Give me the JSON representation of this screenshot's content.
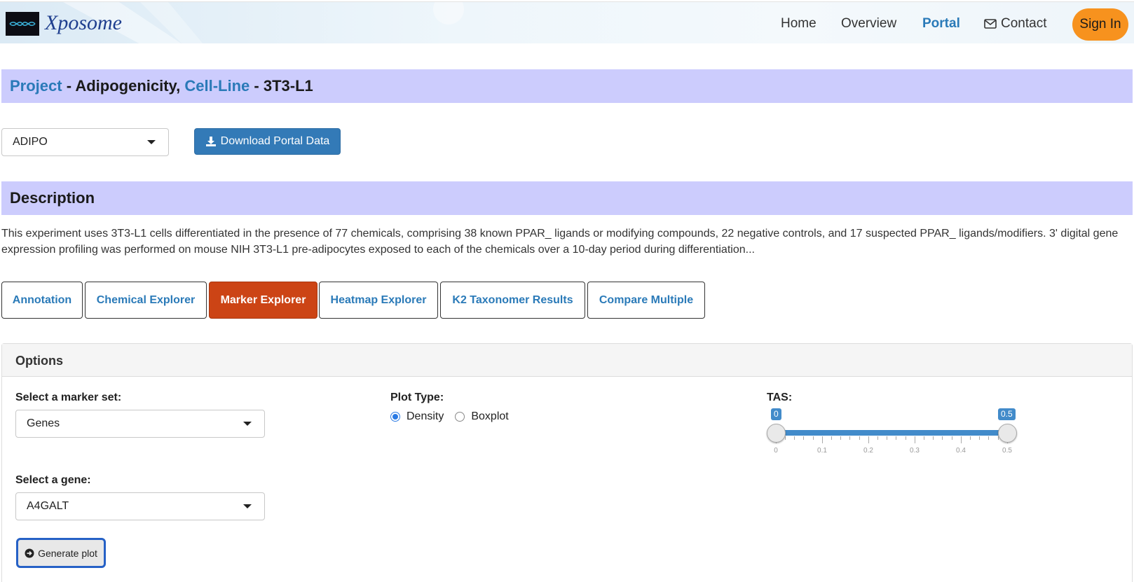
{
  "nav": {
    "brand": "Xposome",
    "links": [
      {
        "label": "Home",
        "active": false
      },
      {
        "label": "Overview",
        "active": false
      },
      {
        "label": "Portal",
        "active": true
      },
      {
        "label": "Contact",
        "active": false,
        "icon": "envelope-icon"
      }
    ],
    "signin": "Sign In"
  },
  "project_header": {
    "project_link": "Project",
    "project_text": " - Adipogenicity, ",
    "cellline_link": "Cell-Line",
    "cellline_text": " - 3T3-L1"
  },
  "project_select": {
    "value": "ADIPO"
  },
  "download_button": {
    "label": "Download Portal Data",
    "icon": "download-icon"
  },
  "description": {
    "heading": "Description",
    "text": "This experiment uses 3T3-L1 cells differentiated in the presence of 77 chemicals, comprising 38 known PPAR_ ligands or modifying compounds, 22 negative controls, and 17 suspected PPAR_ ligands/modifiers. 3' digital gene expression profiling was performed on mouse NIH 3T3-L1 pre-adipocytes exposed to each of the chemicals over a 10-day period during differentiation..."
  },
  "tabs": [
    {
      "label": "Annotation",
      "active": false
    },
    {
      "label": "Chemical Explorer",
      "active": false
    },
    {
      "label": "Marker Explorer",
      "active": true
    },
    {
      "label": "Heatmap Explorer",
      "active": false
    },
    {
      "label": "K2 Taxonomer Results",
      "active": false
    },
    {
      "label": "Compare Multiple",
      "active": false
    }
  ],
  "options": {
    "title": "Options",
    "marker_set_label": "Select a marker set:",
    "marker_set_value": "Genes",
    "gene_label": "Select a gene:",
    "gene_value": "A4GALT",
    "plot_type_label": "Plot Type:",
    "plot_types": [
      {
        "label": "Density",
        "selected": true
      },
      {
        "label": "Boxplot",
        "selected": false
      }
    ],
    "tas_label": "TAS:",
    "tas_min_value": "0",
    "tas_max_value": "0.5",
    "tas_ticks": [
      "0",
      "0.1",
      "0.2",
      "0.3",
      "0.4",
      "0.5"
    ],
    "generate_label": "Generate plot",
    "generate_icon": "arrow-circle-right-icon"
  },
  "colors": {
    "band": "#ccccfd",
    "link": "#2a7ab8",
    "active_tab": "#cc4415",
    "signin": "#f7921e",
    "primary": "#337ab7"
  }
}
